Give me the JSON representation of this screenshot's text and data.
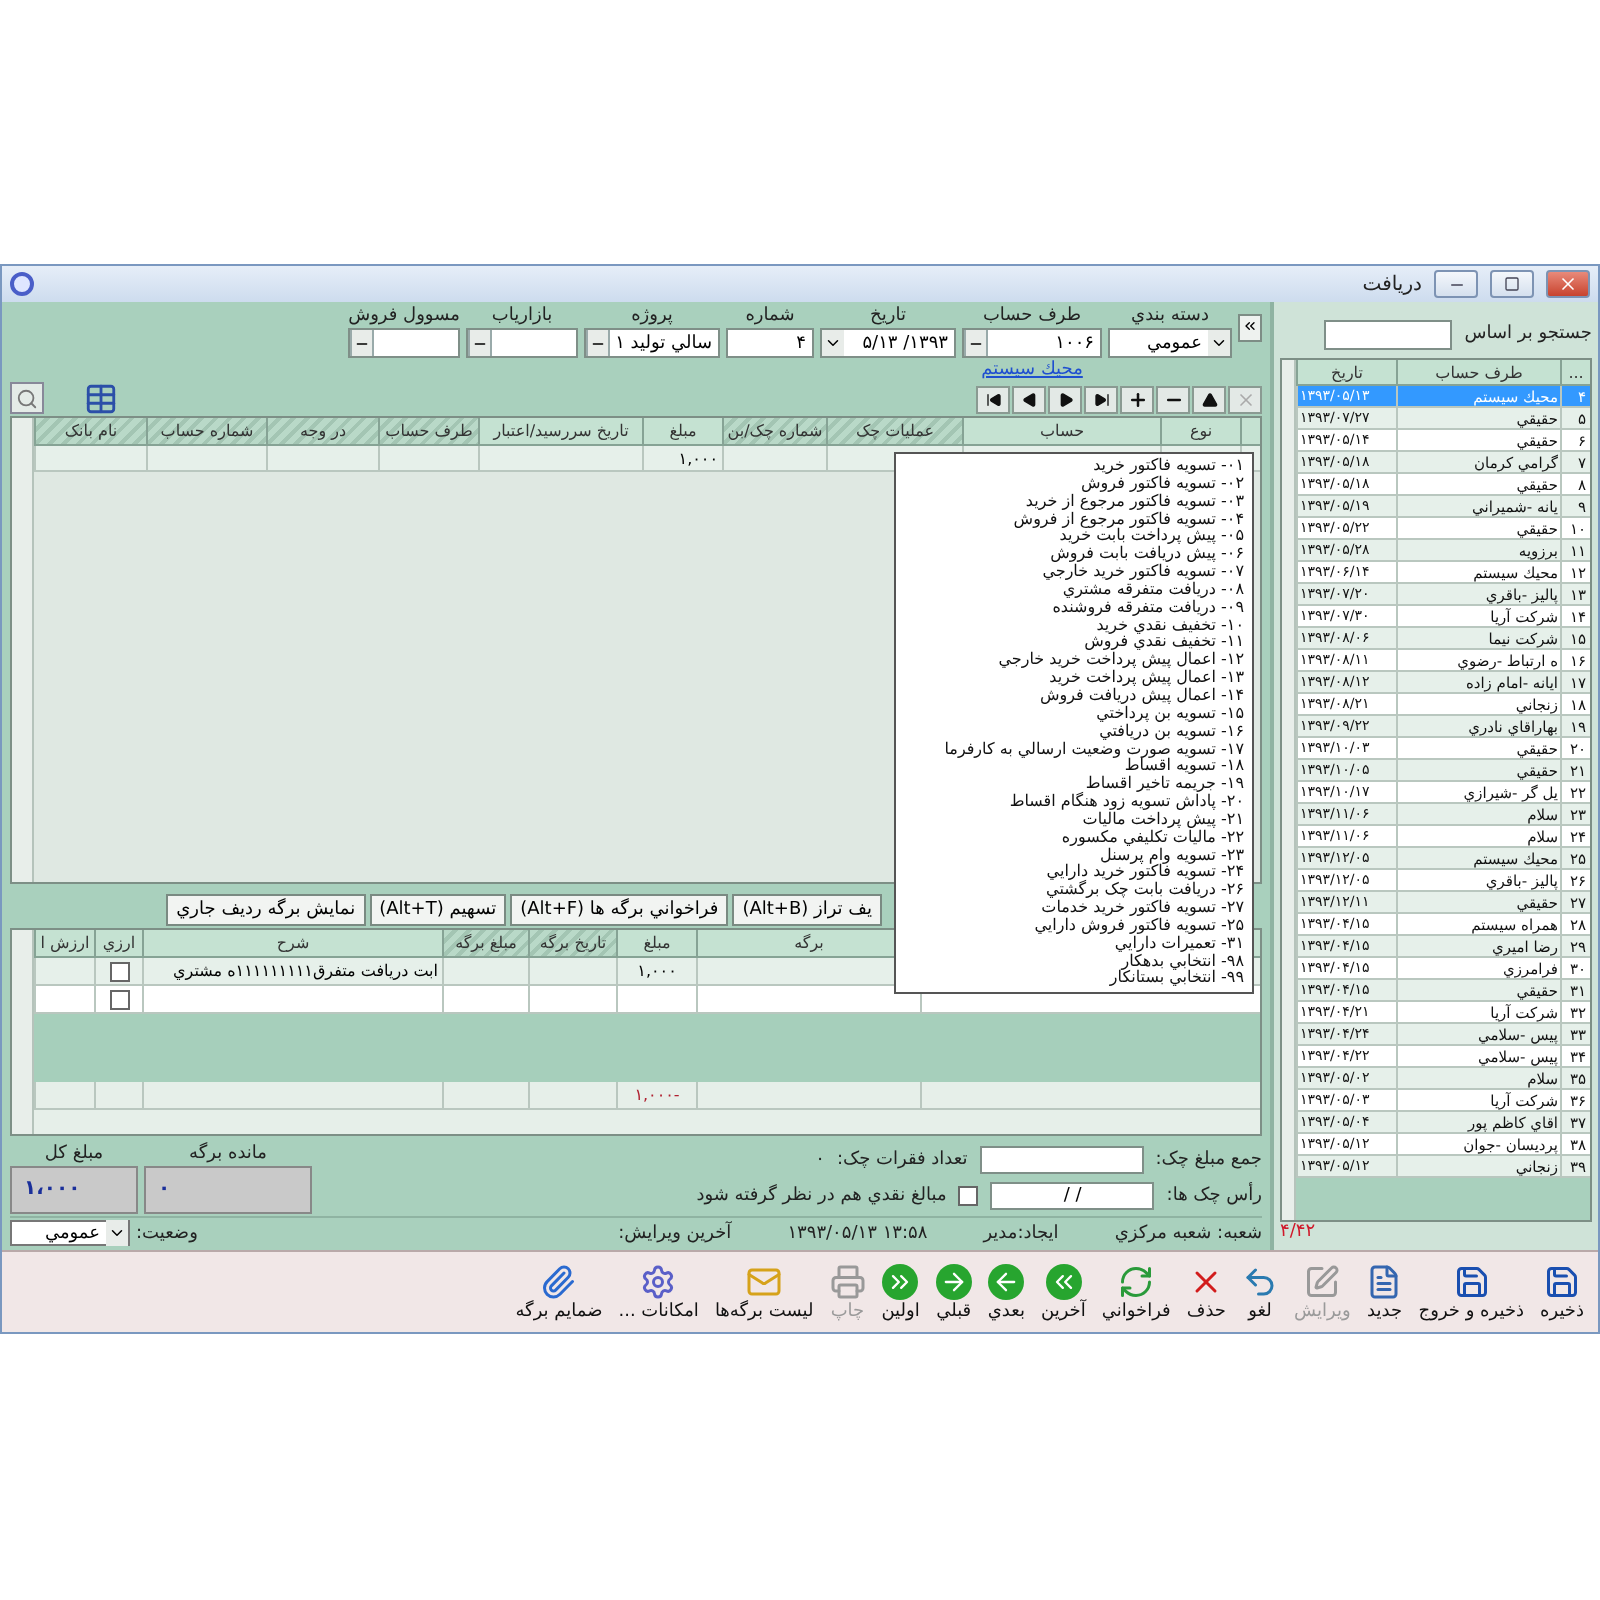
{
  "window": {
    "title": "دريافت"
  },
  "header_form": {
    "fields": [
      {
        "label": "دسته بندي",
        "value": "عمومي",
        "kind": "select"
      },
      {
        "label": "طرف حساب",
        "value": "۱۰۰۶",
        "kind": "lookup",
        "link": "محيك سيستم"
      },
      {
        "label": "تاريخ",
        "value": "۱۳۹۳/ ۵/۱۳",
        "kind": "dropdown"
      },
      {
        "label": "شماره",
        "value": "۴",
        "kind": "text"
      },
      {
        "label": "پروژه",
        "value": "سالي توليد ۱",
        "kind": "lookup"
      },
      {
        "label": "بازارياب",
        "kind": "lookup"
      },
      {
        "label": "مسوول فروش",
        "kind": "lookup"
      }
    ]
  },
  "checks_grid": {
    "columns": [
      {
        "label": "نوع",
        "locked": false
      },
      {
        "label": "حساب",
        "locked": false
      },
      {
        "label": "عمليات چک",
        "locked": true
      },
      {
        "label": "شماره چک/بن",
        "locked": true
      },
      {
        "label": "مبلغ",
        "locked": false
      },
      {
        "label": "تاريخ سررسيد/اعتبار",
        "locked": false
      },
      {
        "label": "طرف حساب",
        "locked": true
      },
      {
        "label": "در وجه",
        "locked": true
      },
      {
        "label": "شماره حساب",
        "locked": true
      },
      {
        "label": "نام بانک",
        "locked": true
      }
    ],
    "rows": [
      [
        "",
        "",
        "",
        "",
        "۱,۰۰۰",
        "",
        "",
        "",
        "",
        ""
      ]
    ]
  },
  "type_menu": {
    "items": [
      "۰۱- تسويه فاکتور خريد",
      "۰۲- تسويه فاکتور فروش",
      "۰۳- تسويه فاکتور مرجوع از خريد",
      "۰۴- تسويه فاکتور مرجوع از فروش",
      "۰۵- پيش پرداخت بابت خريد",
      "۰۶- پيش دريافت بابت فروش",
      "۰۷- تسويه فاکتور خريد خارجي",
      "۰۸- دريافت متفرقه مشتري",
      "۰۹- دريافت متفرقه فروشنده",
      "۱۰- تخفيف نقدي خريد",
      "۱۱- تخفيف نقدي فروش",
      "۱۲- اعمال پيش پرداخت خريد خارجي",
      "۱۳- اعمال پيش پرداخت خريد",
      "۱۴- اعمال پيش دريافت فروش",
      "۱۵- تسويه بن پرداختي",
      "۱۶- تسويه بن دريافتي",
      "۱۷- تسويه صورت وضعيت ارسالي به کارفرما",
      "۱۸- تسويه اقساط",
      "۱۹- جريمه تاخير اقساط",
      "۲۰- پاداش تسويه زود هنگام اقساط",
      "۲۱- پيش پرداخت ماليات",
      "۲۲- ماليات تکليفي مکسوره",
      "۲۳- تسويه وام پرسنل",
      "۲۴- تسويه فاکتور خريد دارايي",
      "۲۶- دريافت بابت چک برگشتي",
      "۲۷- تسويه فاکتور خريد خدمات",
      "۲۵- تسويه فاکتور فروش دارايي",
      "۳۱- تعميرات دارايي",
      "۹۸- انتخابي بدهکار",
      "۹۹- انتخابي بستانکار"
    ]
  },
  "action_tabs": [
    "يف تراز (Alt+B)",
    "فراخواني برگه ها (Alt+F)",
    "تسهيم (Alt+T)",
    "نمايش برگه رديف جاري"
  ],
  "items_grid": {
    "columns": [
      {
        "label": "برگه",
        "locked": false
      },
      {
        "label": "مبلغ",
        "locked": false
      },
      {
        "label": "تاريخ برگه",
        "locked": true
      },
      {
        "label": "مبلغ برگه",
        "locked": true
      },
      {
        "label": "شرح",
        "locked": false
      },
      {
        "label": "ارزي",
        "locked": false
      },
      {
        "label": "ارزش ا",
        "locked": false
      }
    ],
    "rows": [
      {
        "cells": [
          "",
          "۱,۰۰۰",
          "",
          "",
          "ابت دريافت متفرق۱۱۱۱۱۱۱۱۱ه مشتري"
        ],
        "currency": false
      },
      {
        "cells": [
          "",
          "",
          "",
          "",
          ""
        ],
        "currency": false
      }
    ],
    "total": "-۱,۰۰۰"
  },
  "summary": {
    "check_sum_label": "جمع مبلغ چک:",
    "check_count_label": "تعداد فقرات چک:",
    "check_count": "۰",
    "due_label": "رأس چک ها:",
    "due_value": "/ /",
    "cash_included": {
      "label": "مبالغ نقدي هم در نظر گرفته شود",
      "checked": false
    },
    "remaining_label": "مانده برگه",
    "remaining": "۰",
    "total_label": "مبلغ کل",
    "total": "۱،۰۰۰"
  },
  "status_bar": {
    "branch": "شعبه: شعبه مرکزي",
    "created": "ايجاد:مدير",
    "timestamp": "۱۳:۵۸ ۱۳۹۳/۰۵/۱۳",
    "edited_label": "آخرين ويرايش:",
    "state_label": "وضعيت:",
    "state_value": "عمومي"
  },
  "side_panel": {
    "search_label": "جستجو بر اساس",
    "columns": [
      "...",
      "طرف حساب",
      "تاريخ"
    ],
    "counter": "۴/۴۲",
    "rows": [
      {
        "number": "۴",
        "party": "محيك سيستم",
        "date": "۱۳۹۳/۰۵/۱۳",
        "selected": true
      },
      {
        "number": "۵",
        "party": "حقيقي",
        "date": "۱۳۹۳/۰۷/۲۷",
        "selected": false
      },
      {
        "number": "۶",
        "party": "حقيقي",
        "date": "۱۳۹۳/۰۵/۱۴",
        "selected": false
      },
      {
        "number": "۷",
        "party": "گرامي  کرمان",
        "date": "۱۳۹۳/۰۵/۱۸",
        "selected": false
      },
      {
        "number": "۸",
        "party": "حقيقي",
        "date": "۱۳۹۳/۰۵/۱۸",
        "selected": false
      },
      {
        "number": "۹",
        "party": "يانه -شميراني",
        "date": "۱۳۹۳/۰۵/۱۹",
        "selected": false
      },
      {
        "number": "۱۰",
        "party": "حقيقي",
        "date": "۱۳۹۳/۰۵/۲۲",
        "selected": false
      },
      {
        "number": "۱۱",
        "party": "برزويه",
        "date": "۱۳۹۳/۰۵/۲۸",
        "selected": false
      },
      {
        "number": "۱۲",
        "party": "محيك سيستم",
        "date": "۱۳۹۳/۰۶/۱۴",
        "selected": false
      },
      {
        "number": "۱۳",
        "party": "پاليز -باقري",
        "date": "۱۳۹۳/۰۷/۲۰",
        "selected": false
      },
      {
        "number": "۱۴",
        "party": "شرکت آريا",
        "date": "۱۳۹۳/۰۷/۳۰",
        "selected": false
      },
      {
        "number": "۱۵",
        "party": "شرکت نيما",
        "date": "۱۳۹۳/۰۸/۰۶",
        "selected": false
      },
      {
        "number": "۱۶",
        "party": "ه ارتباط -رضوي",
        "date": "۱۳۹۳/۰۸/۱۱",
        "selected": false
      },
      {
        "number": "۱۷",
        "party": "ايانه -امام زاده",
        "date": "۱۳۹۳/۰۸/۱۲",
        "selected": false
      },
      {
        "number": "۱۸",
        "party": "زنجاني",
        "date": "۱۳۹۳/۰۸/۲۱",
        "selected": false
      },
      {
        "number": "۱۹",
        "party": "بهاراقاي نادري",
        "date": "۱۳۹۳/۰۹/۲۲",
        "selected": false
      },
      {
        "number": "۲۰",
        "party": "حقيقي",
        "date": "۱۳۹۳/۱۰/۰۳",
        "selected": false
      },
      {
        "number": "۲۱",
        "party": "حقيقي",
        "date": "۱۳۹۳/۱۰/۰۵",
        "selected": false
      },
      {
        "number": "۲۲",
        "party": "يل گر -شيرازي",
        "date": "۱۳۹۳/۱۰/۱۷",
        "selected": false
      },
      {
        "number": "۲۳",
        "party": "سلام",
        "date": "۱۳۹۳/۱۱/۰۶",
        "selected": false
      },
      {
        "number": "۲۴",
        "party": "سلام",
        "date": "۱۳۹۳/۱۱/۰۶",
        "selected": false
      },
      {
        "number": "۲۵",
        "party": "محيك سيستم",
        "date": "۱۳۹۳/۱۲/۰۵",
        "selected": false
      },
      {
        "number": "۲۶",
        "party": "پاليز -باقري",
        "date": "۱۳۹۳/۱۲/۰۵",
        "selected": false
      },
      {
        "number": "۲۷",
        "party": "حقيقي",
        "date": "۱۳۹۳/۱۲/۱۱",
        "selected": false
      },
      {
        "number": "۲۸",
        "party": "همراه سيستم",
        "date": "۱۳۹۳/۰۴/۱۵",
        "selected": false
      },
      {
        "number": "۲۹",
        "party": "رضا اميري",
        "date": "۱۳۹۳/۰۴/۱۵",
        "selected": false
      },
      {
        "number": "۳۰",
        "party": "فرامرزي",
        "date": "۱۳۹۳/۰۴/۱۵",
        "selected": false
      },
      {
        "number": "۳۱",
        "party": "حقيقي",
        "date": "۱۳۹۳/۰۴/۱۵",
        "selected": false
      },
      {
        "number": "۳۲",
        "party": "شرکت آريا",
        "date": "۱۳۹۳/۰۴/۲۱",
        "selected": false
      },
      {
        "number": "۳۳",
        "party": "پيس -سلامي",
        "date": "۱۳۹۳/۰۴/۲۴",
        "selected": false
      },
      {
        "number": "۳۴",
        "party": "پيس -سلامي",
        "date": "۱۳۹۳/۰۴/۲۲",
        "selected": false
      },
      {
        "number": "۳۵",
        "party": "سلام",
        "date": "۱۳۹۳/۰۵/۰۲",
        "selected": false
      },
      {
        "number": "۳۶",
        "party": "شرکت آريا",
        "date": "۱۳۹۳/۰۵/۰۳",
        "selected": false
      },
      {
        "number": "۳۷",
        "party": "اقاي کاظم پور",
        "date": "۱۳۹۳/۰۵/۰۴",
        "selected": false
      },
      {
        "number": "۳۸",
        "party": "پرديسان -جوان",
        "date": "۱۳۹۳/۰۵/۱۲",
        "selected": false
      },
      {
        "number": "۳۹",
        "party": "زنجاني",
        "date": "۱۳۹۳/۰۵/۱۲",
        "selected": false
      }
    ]
  },
  "toolbar": [
    {
      "label": "ذخيره",
      "kind": "save",
      "disabled": false
    },
    {
      "label": "ذخيره و خروج",
      "kind": "save",
      "disabled": false
    },
    {
      "label": "جديد",
      "kind": "new",
      "disabled": false
    },
    {
      "label": "ويرايش",
      "kind": "edit",
      "disabled": true
    },
    {
      "label": "لغو",
      "kind": "undo",
      "disabled": false
    },
    {
      "label": "حذف",
      "kind": "delete",
      "disabled": false
    },
    {
      "label": "فراخواني",
      "kind": "refresh",
      "disabled": false
    },
    {
      "label": "آخرين",
      "kind": "last",
      "disabled": false
    },
    {
      "label": "بعدي",
      "kind": "next",
      "disabled": false
    },
    {
      "label": "قبلي",
      "kind": "prev",
      "disabled": false
    },
    {
      "label": "اولين",
      "kind": "first",
      "disabled": false
    },
    {
      "label": "چاپ",
      "kind": "print",
      "disabled": true
    },
    {
      "label": "ليست برگه‌ها",
      "kind": "list",
      "disabled": false
    },
    {
      "label": "امکانات ...",
      "kind": "gear",
      "disabled": false
    },
    {
      "label": "ضمايم برگه",
      "kind": "attach",
      "disabled": false
    }
  ]
}
